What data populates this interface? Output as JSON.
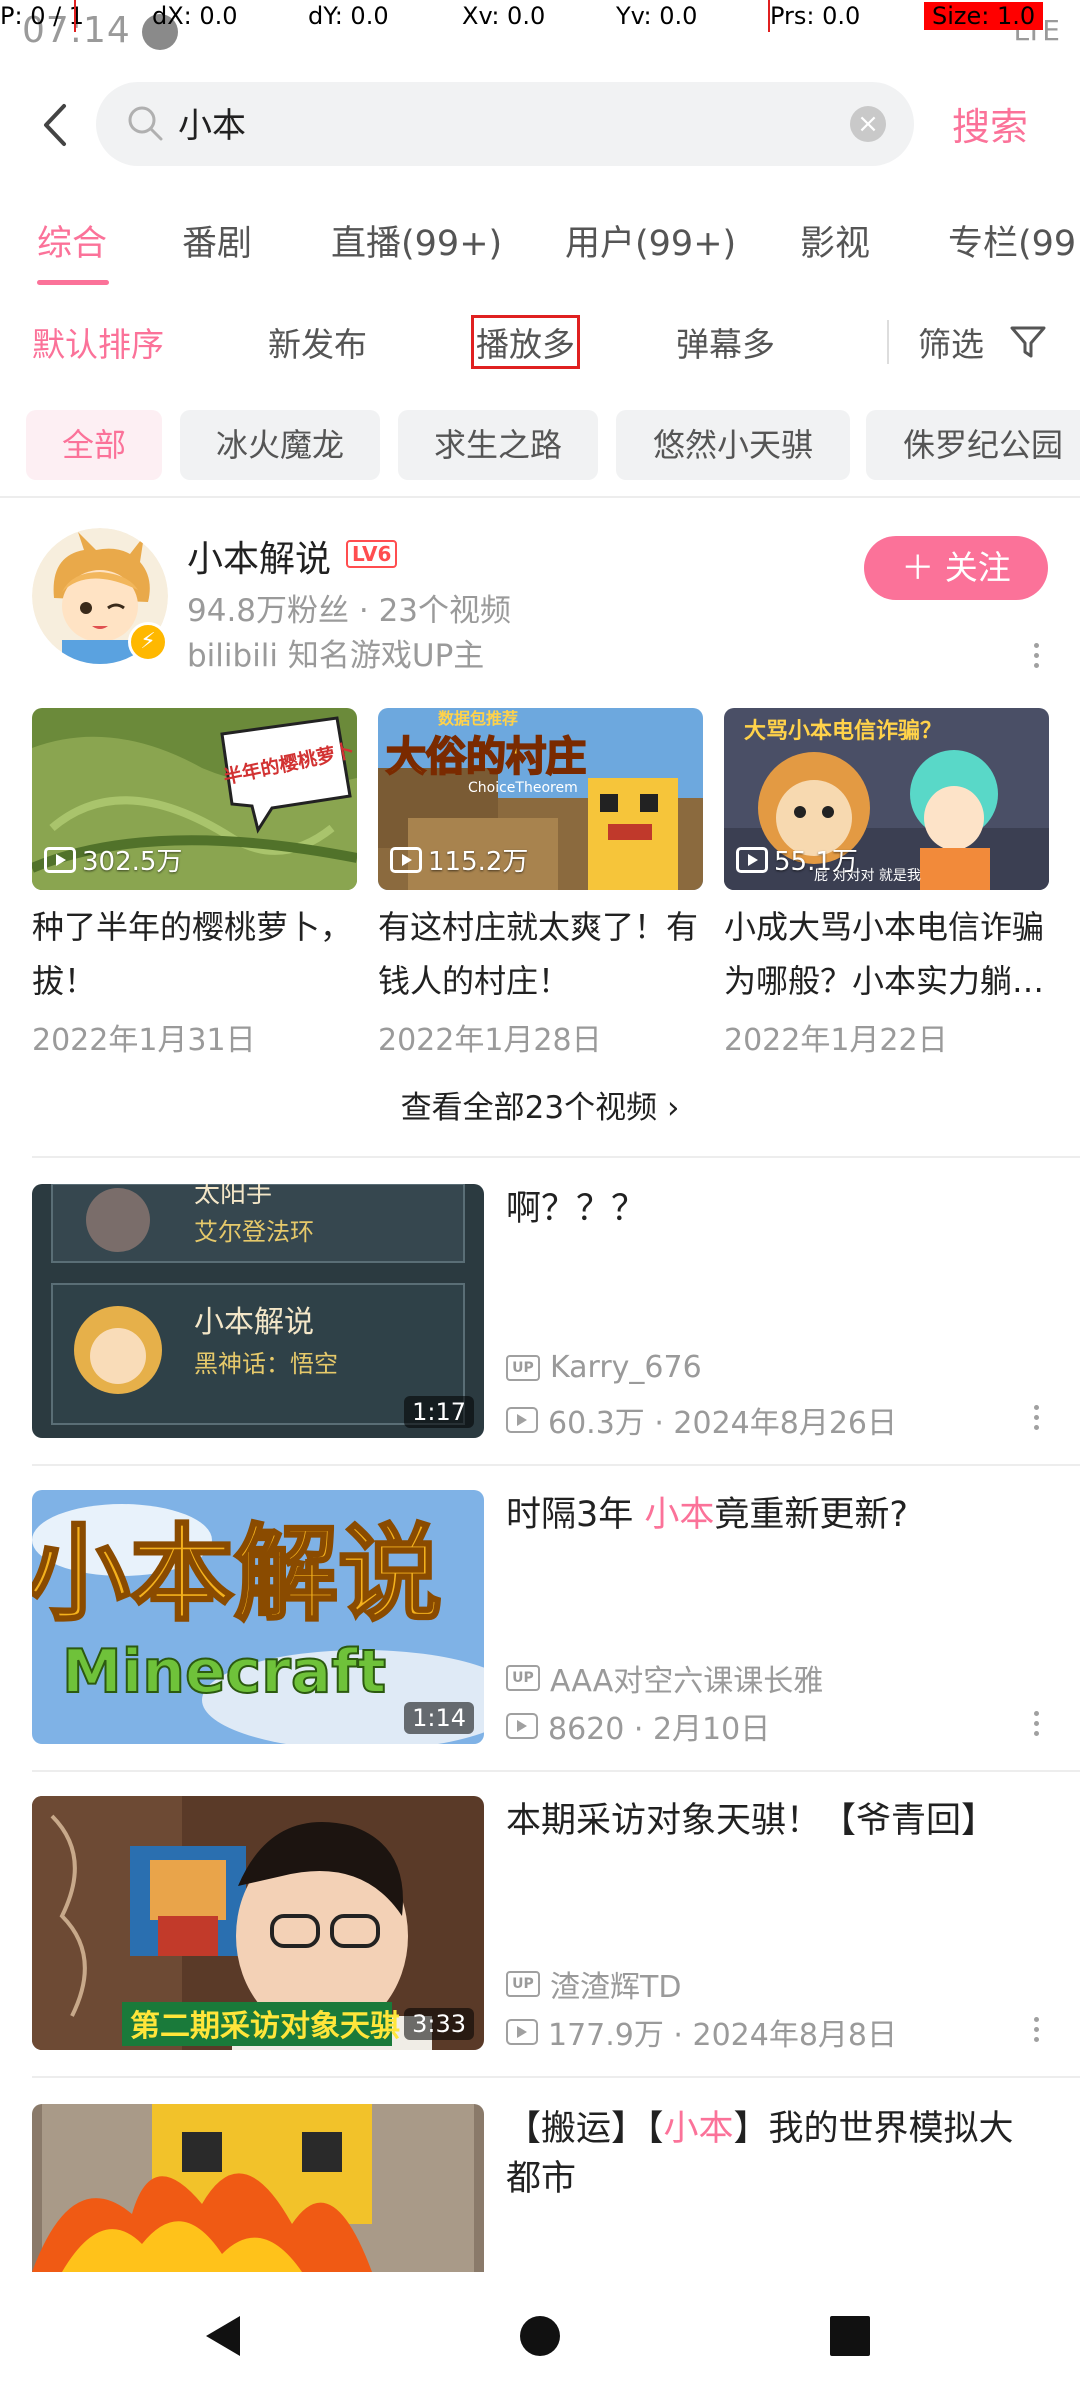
{
  "debug": {
    "p": "P: 0 / 1",
    "dx": "dX: 0.0",
    "dy": "dY: 0.0",
    "xv": "Xv: 0.0",
    "yv": "Yv: 0.0",
    "prs": "Prs: 0.0",
    "size": "Size: 1.0"
  },
  "status": {
    "time": "07:14",
    "right": "LTE"
  },
  "search": {
    "query": "小本",
    "clear": "×",
    "button": "搜索"
  },
  "tabs": [
    {
      "label": "综合",
      "active": true
    },
    {
      "label": "番剧"
    },
    {
      "label": "直播(99+)"
    },
    {
      "label": "用户(99+)"
    },
    {
      "label": "影视"
    },
    {
      "label": "专栏(99"
    }
  ],
  "sort": {
    "default": "默认排序",
    "newest": "新发布",
    "most_played": "播放多",
    "most_danmaku": "弹幕多",
    "filter": "筛选"
  },
  "chips": [
    "全部",
    "冰火魔龙",
    "求生之路",
    "悠然小天骐",
    "侏罗纪公园"
  ],
  "up": {
    "name": "小本解说",
    "level": "LV6",
    "stats": "94.8万粉丝 · 23个视频",
    "desc": "bilibili 知名游戏UP主",
    "follow": "＋ 关注",
    "badge": "⚡",
    "videos": [
      {
        "views": "302.5万",
        "title": "种了半年的樱桃萝卜，拔！",
        "date": "2022年1月31日"
      },
      {
        "views": "115.2万",
        "title": "有这村庄就太爽了！有钱人的村庄！",
        "date": "2022年1月28日"
      },
      {
        "views": "55.1万",
        "title": "小成大骂小本电信诈骗为哪般？小本实力躺…",
        "date": "2022年1月22日"
      }
    ],
    "see_all": "查看全部23个视频 ›"
  },
  "results": [
    {
      "title": "啊？？？",
      "highlight": "",
      "title_after": "",
      "up": "Karry_676",
      "stat": "60.3万 · 2024年8月26日",
      "duration": "1:17"
    },
    {
      "title": "时隔3年 ",
      "highlight": "小本",
      "title_after": "竟重新更新?",
      "up": "AAA对空六课课长雅",
      "stat": "8620 · 2月10日",
      "duration": "1:14"
    },
    {
      "title": "本期采访对象天骐！【爷青回】",
      "highlight": "",
      "title_after": "",
      "up": "渣渣辉TD",
      "stat": "177.9万 · 2024年8月8日",
      "duration": "3:33"
    },
    {
      "title": "【搬运】【",
      "highlight": "小本",
      "title_after": "】我的世界模拟大都市",
      "up": "",
      "stat": "",
      "duration": ""
    }
  ],
  "thumb_text": {
    "r1_line1": "太阳手",
    "r1_line2": "艾尔登法环",
    "r1_line3": "小本解说",
    "r1_line4": "黑神话：悟空",
    "r2_big": "小本解说",
    "r2_small": "Minecraft",
    "r3_caption": "第二期采访对象天骐",
    "v1_caption": "半年的樱桃萝卜",
    "v2_top": "数据包推荐",
    "v2_big": "大俗的村庄",
    "v2_small": "ChoiceTheorem",
    "v3_caption": "大骂小本电信诈骗？",
    "v3_sub": "屁 对对对 就是我"
  },
  "colors": {
    "accent": "#fb7299",
    "debug_box": "#e02020"
  }
}
